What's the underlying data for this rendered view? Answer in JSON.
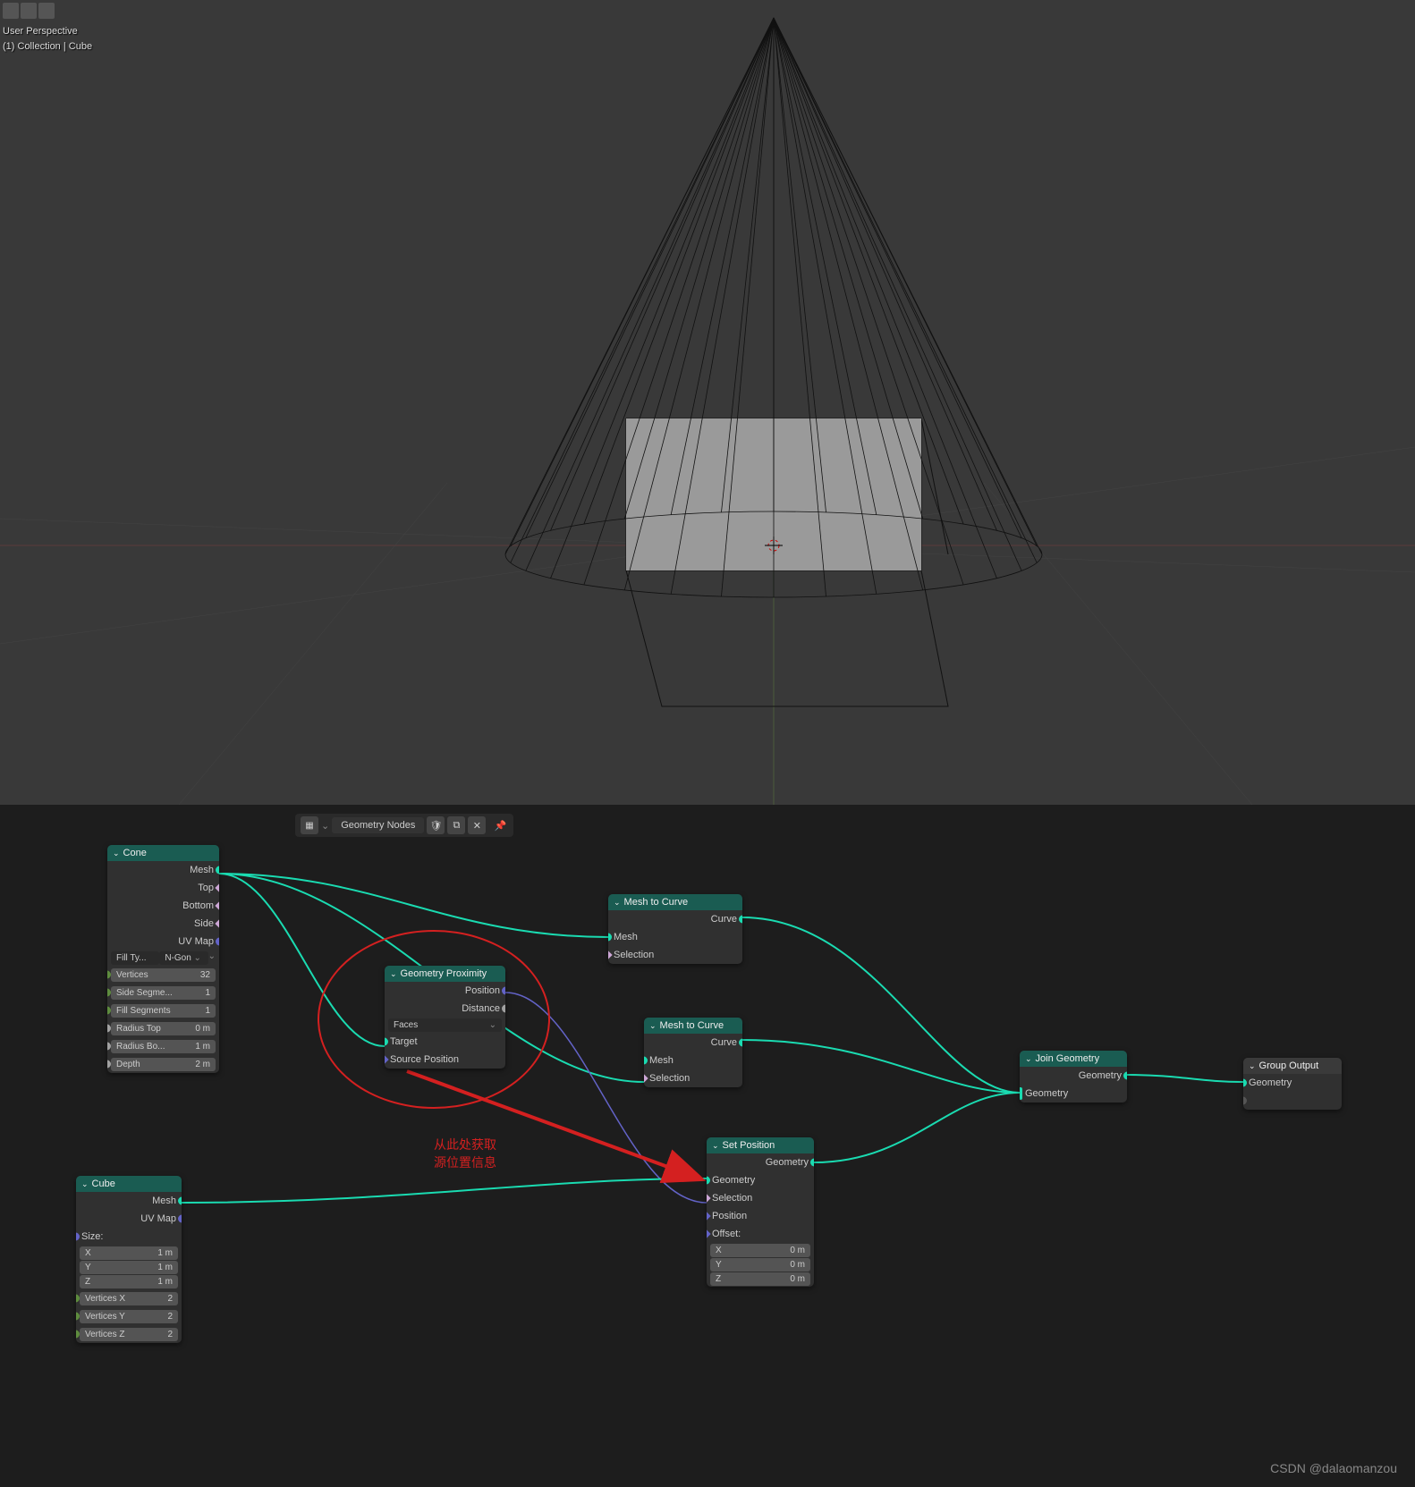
{
  "viewport": {
    "perspective": "User Perspective",
    "breadcrumb": "(1) Collection | Cube"
  },
  "toolbar": {
    "label": "Geometry Nodes"
  },
  "nodes": {
    "cone": {
      "title": "Cone",
      "out_mesh": "Mesh",
      "out_top": "Top",
      "out_bottom": "Bottom",
      "out_side": "Side",
      "out_uv": "UV Map",
      "fill_label": "Fill Ty...",
      "fill_value": "N-Gon",
      "vertices_label": "Vertices",
      "vertices_value": "32",
      "side_seg_label": "Side Segme...",
      "side_seg_value": "1",
      "fill_seg_label": "Fill Segments",
      "fill_seg_value": "1",
      "rtop_label": "Radius Top",
      "rtop_value": "0 m",
      "rbot_label": "Radius Bo...",
      "rbot_value": "1 m",
      "depth_label": "Depth",
      "depth_value": "2 m"
    },
    "cube": {
      "title": "Cube",
      "out_mesh": "Mesh",
      "out_uv": "UV Map",
      "size_label": "Size:",
      "x_label": "X",
      "x_value": "1 m",
      "y_label": "Y",
      "y_value": "1 m",
      "z_label": "Z",
      "z_value": "1 m",
      "vx_label": "Vertices X",
      "vx_value": "2",
      "vy_label": "Vertices Y",
      "vy_value": "2",
      "vz_label": "Vertices Z",
      "vz_value": "2"
    },
    "prox": {
      "title": "Geometry Proximity",
      "out_pos": "Position",
      "out_dist": "Distance",
      "mode": "Faces",
      "in_target": "Target",
      "in_src": "Source Position"
    },
    "m2c1": {
      "title": "Mesh to Curve",
      "out_curve": "Curve",
      "in_mesh": "Mesh",
      "in_sel": "Selection"
    },
    "m2c2": {
      "title": "Mesh to Curve",
      "out_curve": "Curve",
      "in_mesh": "Mesh",
      "in_sel": "Selection"
    },
    "setpos": {
      "title": "Set Position",
      "out_geo": "Geometry",
      "in_geo": "Geometry",
      "in_sel": "Selection",
      "in_pos": "Position",
      "off_label": "Offset:",
      "ox_label": "X",
      "ox_value": "0 m",
      "oy_label": "Y",
      "oy_value": "0 m",
      "oz_label": "Z",
      "oz_value": "0 m"
    },
    "join": {
      "title": "Join Geometry",
      "out_geo": "Geometry",
      "in_geo": "Geometry"
    },
    "output": {
      "title": "Group Output",
      "in_geo": "Geometry"
    }
  },
  "annotation": {
    "line1": "从此处获取",
    "line2": "源位置信息"
  },
  "watermark": "CSDN @dalaomanzou"
}
